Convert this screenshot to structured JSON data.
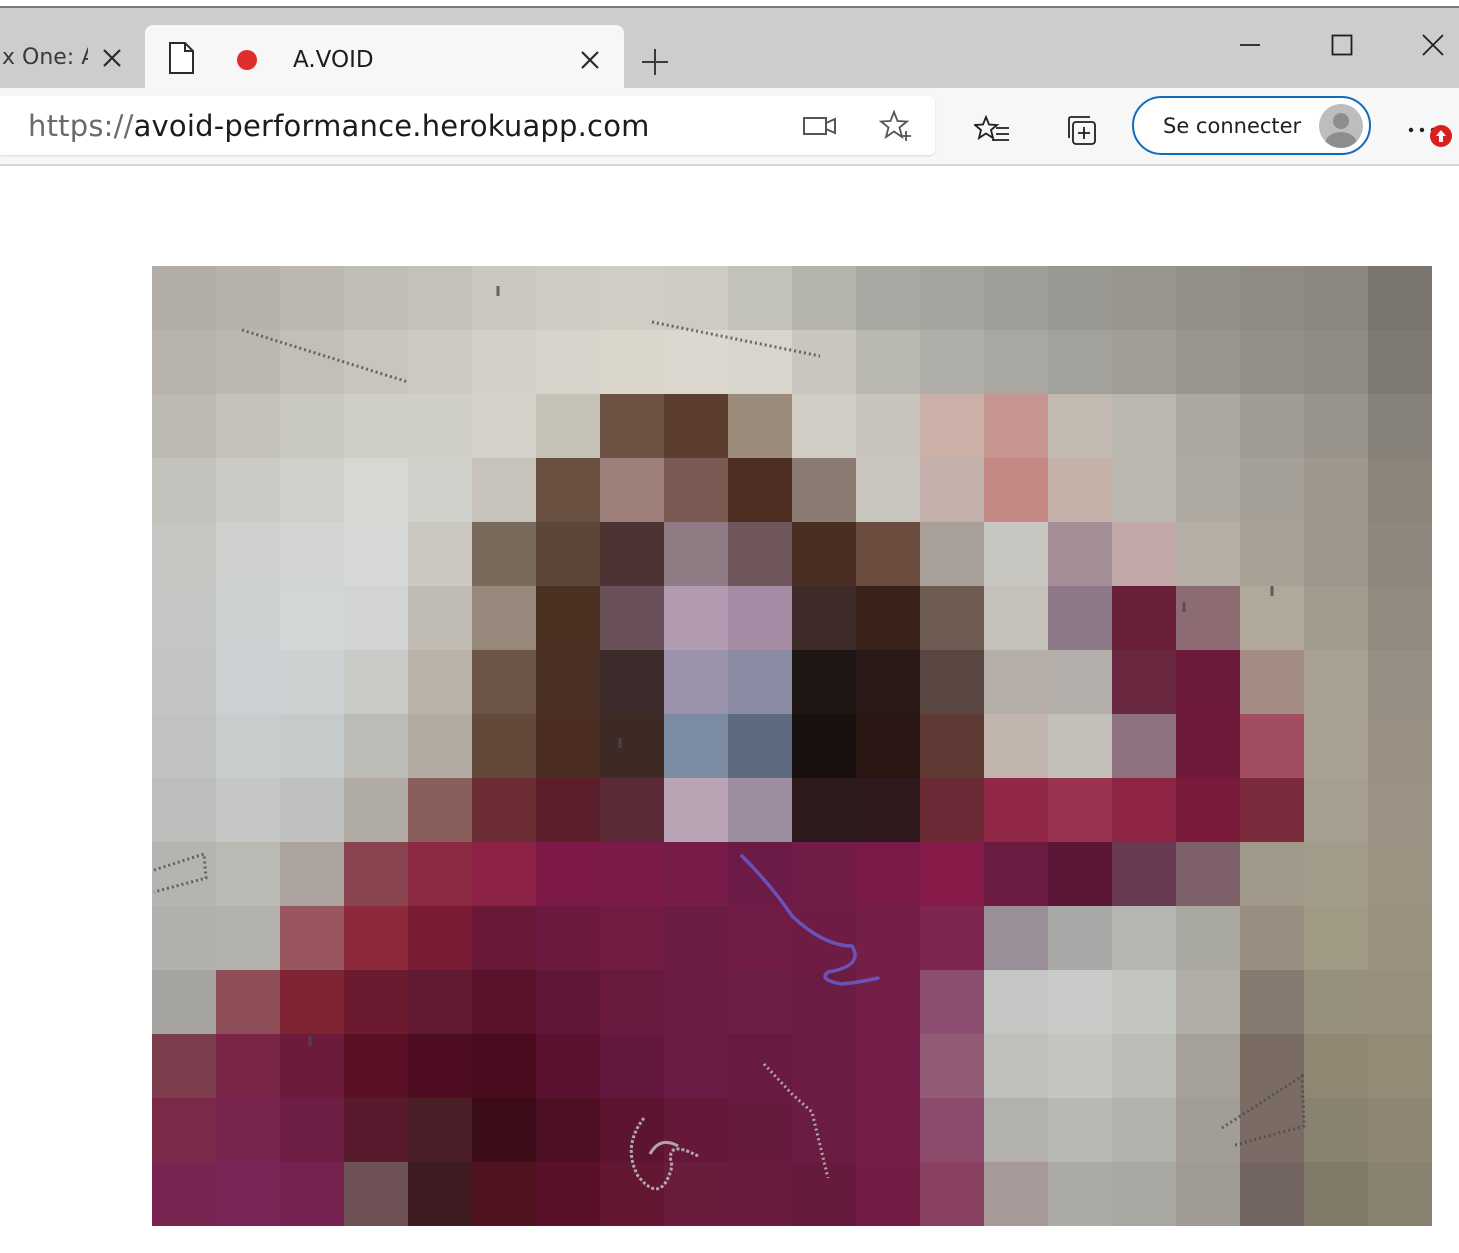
{
  "browser": {
    "tabs": [
      {
        "title": "x One: A",
        "active": false
      },
      {
        "title": "A.VOID",
        "active": true,
        "recording": true
      }
    ],
    "new_tab_label": "+",
    "window_controls": [
      "minimize-icon",
      "maximize-icon",
      "close-icon"
    ]
  },
  "address_bar": {
    "scheme": "https://",
    "host": "avoid-performance.herokuapp.com"
  },
  "toolbar": {
    "signin_label": "Se connecter",
    "icons": [
      "camera-icon",
      "add-favorite-icon",
      "favorites-icon",
      "collections-icon",
      "more-icon"
    ]
  },
  "colors": {
    "accent": "#0f6cbd",
    "record": "#e02d2d",
    "badge": "#d92020"
  },
  "content": {
    "image_kind": "pixelated webcam frame with drawn strokes",
    "mosaic": [
      [
        "#b2ada6",
        "#b6b2aa",
        "#bcb8b0",
        "#c0bdb5",
        "#c4c1b9",
        "#cac7bf",
        "#cfccc4",
        "#d0cdc5",
        "#cdcbc3",
        "#c2c1ba",
        "#b4b4ad",
        "#a8a8a2",
        "#a4a39d",
        "#a09e98",
        "#9a9892",
        "#97958e",
        "#939089",
        "#8f8b84",
        "#8b877f",
        "#7a766f"
      ],
      [
        "#b7b3ab",
        "#bcb8b0",
        "#c2bfb7",
        "#c8c5bd",
        "#cccac2",
        "#d2d0c8",
        "#d6d3cb",
        "#dad6cc",
        "#dcd8cf",
        "#d8d5cc",
        "#c8c6be",
        "#b9b8b1",
        "#b0aea8",
        "#a9a7a1",
        "#a3a19b",
        "#9f9d96",
        "#99958e",
        "#948f87",
        "#8f8a82",
        "#7e7a73"
      ],
      [
        "#bdbab2",
        "#c4c2ba",
        "#c9c8c1",
        "#cfcfc8",
        "#d0cfc7",
        "#d4d2c9",
        "#c7c2b8",
        "#6e5244",
        "#5c3e2f",
        "#9b8b7b",
        "#d0cdc4",
        "#c8c3bb",
        "#cbb0a8",
        "#c79690",
        "#c2b9b1",
        "#b9b7af",
        "#aba8a0",
        "#a09c94",
        "#99948b",
        "#878279"
      ],
      [
        "#c3c2bc",
        "#cbcbc5",
        "#cfd0ca",
        "#d6d8d3",
        "#d1d1cb",
        "#c8c3ba",
        "#6a5040",
        "#9c7f78",
        "#7a5a52",
        "#4e2e22",
        "#8b7b72",
        "#c9c6bf",
        "#c3b0ab",
        "#c48985",
        "#c6b1a8",
        "#bbb7ae",
        "#aeaaa2",
        "#a49f97",
        "#9d978e",
        "#8a8479"
      ],
      [
        "#c5c5c1",
        "#ced0cd",
        "#d3d5d2",
        "#d6d8d5",
        "#cac8c1",
        "#7a6a5c",
        "#5d4538",
        "#4b3431",
        "#8f7b84",
        "#6e565a",
        "#4a2e24",
        "#6b4d40",
        "#a9a09a",
        "#c8c6c0",
        "#a28e94",
        "#c2a8a8",
        "#b7aea6",
        "#a7a196",
        "#9c968c",
        "#8d877d"
      ],
      [
        "#c4c6c4",
        "#cdd1d1",
        "#d1d6d6",
        "#d1d4d2",
        "#c0bcb3",
        "#97887c",
        "#4c3022",
        "#6a5058",
        "#b29ab0",
        "#a48ba3",
        "#3e2a28",
        "#3a221a",
        "#6e5c52",
        "#c4c0ba",
        "#8c7886",
        "#6b2039",
        "#8c6c72",
        "#b0a898",
        "#a29c8e",
        "#918a7f"
      ],
      [
        "#c2c5c4",
        "#cbd1d2",
        "#ccd1d2",
        "#c8cac6",
        "#b8b2a9",
        "#6c5546",
        "#4a3024",
        "#3e2c2c",
        "#9a93ab",
        "#8a8aa2",
        "#1e1615",
        "#2a1a17",
        "#5a4742",
        "#b5aea8",
        "#b3aeaa",
        "#6a2840",
        "#6d1939",
        "#a38c84",
        "#a8a192",
        "#968f83"
      ],
      [
        "#bfc2c1",
        "#c8cdcd",
        "#c5cacb",
        "#bcbcb6",
        "#b3aaa1",
        "#62493a",
        "#4c2d22",
        "#3d2a24",
        "#7b8ca2",
        "#5e6a7f",
        "#19110f",
        "#2a1714",
        "#603a35",
        "#c0b4ad",
        "#c3c0ba",
        "#8f7280",
        "#6f1a3a",
        "#a24e60",
        "#a9a193",
        "#998f83"
      ],
      [
        "#bcbebc",
        "#c4c7c6",
        "#bfc1bf",
        "#b0aba4",
        "#8a5e5a",
        "#6c2c33",
        "#5c1e2a",
        "#5a2a36",
        "#b8a4b4",
        "#9d8da0",
        "#2d1a1c",
        "#2e1a1c",
        "#6c2a36",
        "#922848",
        "#9a3350",
        "#8f2545",
        "#7a1a3a",
        "#7a2a3a",
        "#a69f91",
        "#9c9284"
      ],
      [
        "#b4b5b1",
        "#bab9b4",
        "#aca39e",
        "#8a4450",
        "#8c2a44",
        "#8c2246",
        "#7e1a48",
        "#7c1a4a",
        "#781c4a",
        "#6c1a46",
        "#721c48",
        "#7a1a48",
        "#861a48",
        "#6c1c42",
        "#5c1638",
        "#6a3a55",
        "#7e6068",
        "#a09888",
        "#a49c8a",
        "#9c9382"
      ],
      [
        "#b0b0ac",
        "#b3b1ac",
        "#99565e",
        "#8c2a3c",
        "#7a1c34",
        "#6a1838",
        "#6e1a40",
        "#721c44",
        "#6c1b44",
        "#701c46",
        "#6e1c46",
        "#761e4a",
        "#7e2650",
        "#9a8e98",
        "#a8a8a6",
        "#b4b6b2",
        "#a9a8a1",
        "#9a8e80",
        "#a09984",
        "#9a917f"
      ],
      [
        "#a6a4a0",
        "#8e4e58",
        "#7e2432",
        "#6c1a30",
        "#621a32",
        "#5a122a",
        "#601636",
        "#6a1a3e",
        "#6a1c42",
        "#6c1e44",
        "#6a1c42",
        "#741e48",
        "#8c4e70",
        "#c4c6c3",
        "#c8cbc8",
        "#c3c5c1",
        "#b0aea7",
        "#857a70",
        "#958f7c",
        "#978f7c"
      ],
      [
        "#7c3e4c",
        "#7a2446",
        "#6c1c3a",
        "#5c1026",
        "#4e0c22",
        "#480c1e",
        "#5a1230",
        "#641840",
        "#6a1c44",
        "#681a42",
        "#6c1c44",
        "#761e4a",
        "#925c76",
        "#bfbfbb",
        "#c4c5c1",
        "#bdbdb8",
        "#a5a099",
        "#7a6c62",
        "#8f8772",
        "#948b76"
      ],
      [
        "#7c2a4a",
        "#7a2550",
        "#6e1e44",
        "#5a1a2e",
        "#4a1e26",
        "#3c0c18",
        "#4e0e24",
        "#5c1430",
        "#66183a",
        "#661a3e",
        "#6a1c42",
        "#741e48",
        "#8c4a6c",
        "#b2b1ad",
        "#b8b8b4",
        "#b3b3ae",
        "#a29e97",
        "#7a6c64",
        "#8a8270",
        "#8e8672"
      ],
      [
        "#7a2452",
        "#7c2658",
        "#762250",
        "#6e5256",
        "#3e1c22",
        "#501420",
        "#5a1028",
        "#621632",
        "#6a1c3c",
        "#6a1c40",
        "#661a3e",
        "#721c46",
        "#8a4262",
        "#a89a98",
        "#acaaa6",
        "#a9a7a2",
        "#9f9a93",
        "#726460",
        "#807a68",
        "#8a8270"
      ]
    ]
  }
}
